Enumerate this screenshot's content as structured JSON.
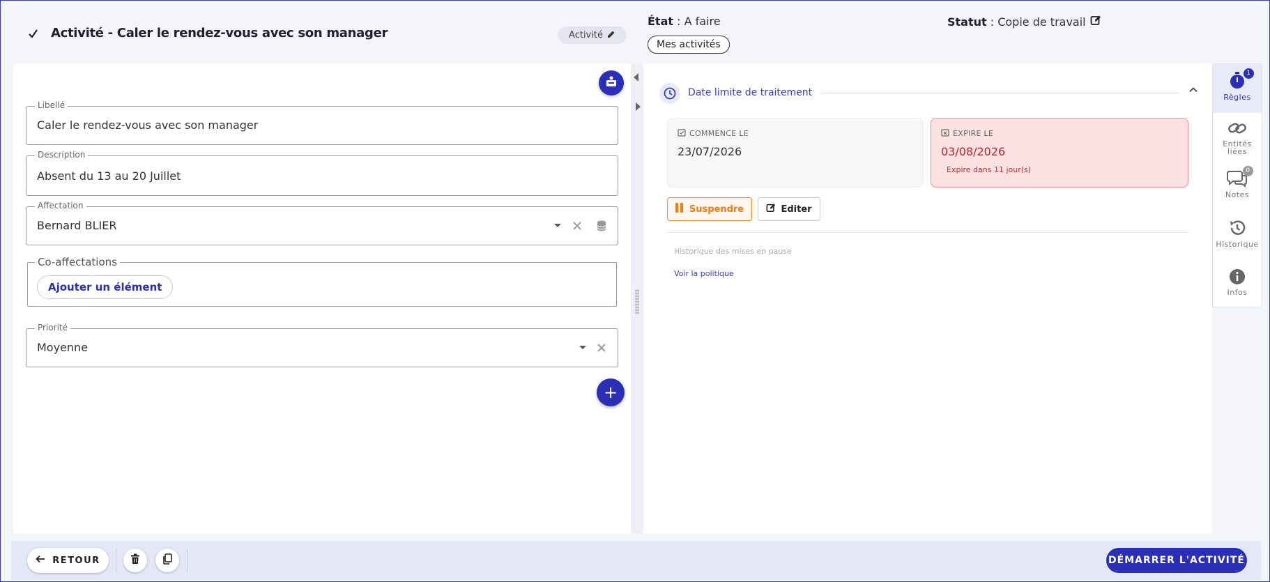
{
  "header": {
    "title": "Activité - Caler le rendez-vous avec son manager",
    "type_chip": "Activité",
    "etat_label": "État",
    "etat_value": " : A faire",
    "mes_activites": "Mes activités",
    "statut_label": "Statut",
    "statut_value": " : Copie de travail"
  },
  "form": {
    "libelle": {
      "label": "Libellé",
      "value": "Caler le rendez-vous avec son manager"
    },
    "description": {
      "label": "Description",
      "value": "Absent du 13 au 20 Juillet"
    },
    "affectation": {
      "label": "Affectation",
      "value": "Bernard BLIER"
    },
    "co_affectations": {
      "label": "Co-affectations",
      "add_label": "Ajouter un élément"
    },
    "priorite": {
      "label": "Priorité",
      "value": "Moyenne"
    },
    "add_fab": "+"
  },
  "deadline": {
    "title": "Date limite de traitement",
    "start_label": "COMMENCE LE",
    "start_date": "23/07/2026",
    "end_label": "EXPIRE LE",
    "end_date": "03/08/2026",
    "expires_in": "Expire dans 11 jour(s)",
    "suspend_label": "Suspendre",
    "edit_label": "Editer",
    "pause_history": "Historique des mises en pause",
    "policy_link": "Voir la politique"
  },
  "rail": {
    "items": [
      {
        "label": "Règles",
        "badge": "1"
      },
      {
        "label": "Entités liées"
      },
      {
        "label": "Notes",
        "badge": "0"
      },
      {
        "label": "Historique"
      },
      {
        "label": "Infos"
      }
    ]
  },
  "footer": {
    "back_label": "RETOUR",
    "start_label": "DÉMARRER L'ACTIVITÉ"
  },
  "colors": {
    "primary": "#2b2fb5",
    "warning": "#ef7d14",
    "danger": "#c0262d",
    "danger_bg": "#fde2e3"
  }
}
